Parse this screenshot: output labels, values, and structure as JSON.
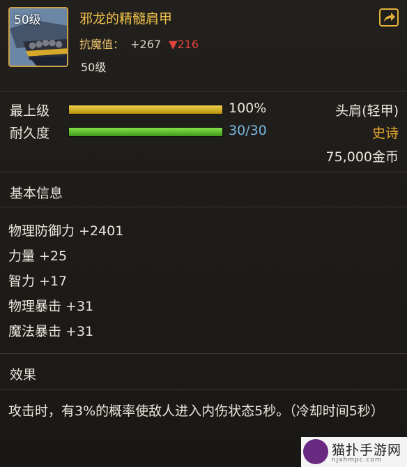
{
  "item": {
    "level_badge": "50级",
    "name": "邪龙的精髓肩甲",
    "resist_label": "抗魔值：",
    "resist_plus": "+267",
    "resist_down": "▼216",
    "level_text": "50级",
    "icon": "dragon-shoulder-armor-icon"
  },
  "stats": {
    "max_level_label": "最上级",
    "max_level_value": "100%",
    "max_level_fraction": 1.0,
    "durability_label": "耐久度",
    "durability_value": "30/30",
    "durability_fraction": 1.0,
    "slot_type": "头肩(轻甲)",
    "rarity": "史诗",
    "price": "75,000金币"
  },
  "basic_info": {
    "title": "基本信息",
    "attributes": [
      "物理防御力 +2401",
      "力量 +25",
      "智力 +17",
      "物理暴击 +31",
      "魔法暴击 +31"
    ]
  },
  "effect": {
    "title": "效果",
    "text": "攻击时，有3%的概率使敌人进入内伤状态5秒。（冷却时间5秒）"
  },
  "watermark": {
    "text": "猫扑手游网",
    "url": "njxhmpc.com"
  },
  "colors": {
    "gold": "#f1c24c",
    "rarity": "#e6a92e",
    "durability": "#7ab7e0",
    "down_arrow": "#e0443a"
  }
}
